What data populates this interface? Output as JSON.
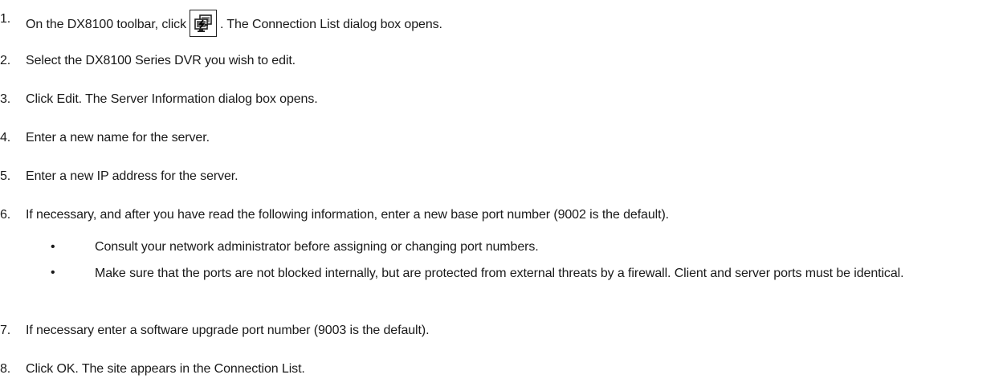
{
  "steps": [
    {
      "number": "1.",
      "text_before": "On the DX8100 toolbar, click",
      "icon": "connection-list-icon",
      "text_after": ". The Connection List dialog box opens."
    },
    {
      "number": "2.",
      "text": "Select the DX8100 Series DVR you wish to edit."
    },
    {
      "number": "3.",
      "text": "Click Edit. The Server Information dialog box opens."
    },
    {
      "number": "4.",
      "text": "Enter a new name for the server."
    },
    {
      "number": "5.",
      "text": "Enter a new IP address for the server."
    },
    {
      "number": "6.",
      "text": "If necessary, and after you have read the following information, enter a new base port number (9002 is the default)."
    },
    {
      "number": "7.",
      "text": "If necessary enter a software upgrade port number (9003 is the default)."
    },
    {
      "number": "8.",
      "text": "Click OK. The site appears in the Connection List."
    }
  ],
  "bullets": [
    {
      "symbol": "•",
      "text": "Consult your network administrator before assigning or changing port numbers."
    },
    {
      "symbol": "•",
      "text": "Make sure that the ports are not blocked internally, but are protected from external threats by a firewall. Client and server ports must be identical."
    }
  ]
}
